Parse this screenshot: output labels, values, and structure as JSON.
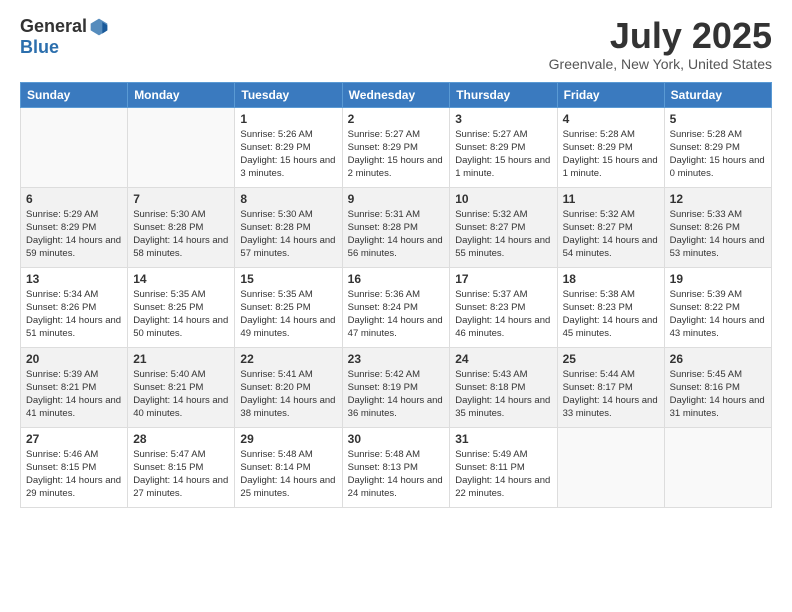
{
  "logo": {
    "general": "General",
    "blue": "Blue"
  },
  "title": {
    "month": "July 2025",
    "location": "Greenvale, New York, United States"
  },
  "headers": [
    "Sunday",
    "Monday",
    "Tuesday",
    "Wednesday",
    "Thursday",
    "Friday",
    "Saturday"
  ],
  "weeks": [
    [
      {
        "day": "",
        "info": ""
      },
      {
        "day": "",
        "info": ""
      },
      {
        "day": "1",
        "info": "Sunrise: 5:26 AM\nSunset: 8:29 PM\nDaylight: 15 hours and 3 minutes."
      },
      {
        "day": "2",
        "info": "Sunrise: 5:27 AM\nSunset: 8:29 PM\nDaylight: 15 hours and 2 minutes."
      },
      {
        "day": "3",
        "info": "Sunrise: 5:27 AM\nSunset: 8:29 PM\nDaylight: 15 hours and 1 minute."
      },
      {
        "day": "4",
        "info": "Sunrise: 5:28 AM\nSunset: 8:29 PM\nDaylight: 15 hours and 1 minute."
      },
      {
        "day": "5",
        "info": "Sunrise: 5:28 AM\nSunset: 8:29 PM\nDaylight: 15 hours and 0 minutes."
      }
    ],
    [
      {
        "day": "6",
        "info": "Sunrise: 5:29 AM\nSunset: 8:29 PM\nDaylight: 14 hours and 59 minutes."
      },
      {
        "day": "7",
        "info": "Sunrise: 5:30 AM\nSunset: 8:28 PM\nDaylight: 14 hours and 58 minutes."
      },
      {
        "day": "8",
        "info": "Sunrise: 5:30 AM\nSunset: 8:28 PM\nDaylight: 14 hours and 57 minutes."
      },
      {
        "day": "9",
        "info": "Sunrise: 5:31 AM\nSunset: 8:28 PM\nDaylight: 14 hours and 56 minutes."
      },
      {
        "day": "10",
        "info": "Sunrise: 5:32 AM\nSunset: 8:27 PM\nDaylight: 14 hours and 55 minutes."
      },
      {
        "day": "11",
        "info": "Sunrise: 5:32 AM\nSunset: 8:27 PM\nDaylight: 14 hours and 54 minutes."
      },
      {
        "day": "12",
        "info": "Sunrise: 5:33 AM\nSunset: 8:26 PM\nDaylight: 14 hours and 53 minutes."
      }
    ],
    [
      {
        "day": "13",
        "info": "Sunrise: 5:34 AM\nSunset: 8:26 PM\nDaylight: 14 hours and 51 minutes."
      },
      {
        "day": "14",
        "info": "Sunrise: 5:35 AM\nSunset: 8:25 PM\nDaylight: 14 hours and 50 minutes."
      },
      {
        "day": "15",
        "info": "Sunrise: 5:35 AM\nSunset: 8:25 PM\nDaylight: 14 hours and 49 minutes."
      },
      {
        "day": "16",
        "info": "Sunrise: 5:36 AM\nSunset: 8:24 PM\nDaylight: 14 hours and 47 minutes."
      },
      {
        "day": "17",
        "info": "Sunrise: 5:37 AM\nSunset: 8:23 PM\nDaylight: 14 hours and 46 minutes."
      },
      {
        "day": "18",
        "info": "Sunrise: 5:38 AM\nSunset: 8:23 PM\nDaylight: 14 hours and 45 minutes."
      },
      {
        "day": "19",
        "info": "Sunrise: 5:39 AM\nSunset: 8:22 PM\nDaylight: 14 hours and 43 minutes."
      }
    ],
    [
      {
        "day": "20",
        "info": "Sunrise: 5:39 AM\nSunset: 8:21 PM\nDaylight: 14 hours and 41 minutes."
      },
      {
        "day": "21",
        "info": "Sunrise: 5:40 AM\nSunset: 8:21 PM\nDaylight: 14 hours and 40 minutes."
      },
      {
        "day": "22",
        "info": "Sunrise: 5:41 AM\nSunset: 8:20 PM\nDaylight: 14 hours and 38 minutes."
      },
      {
        "day": "23",
        "info": "Sunrise: 5:42 AM\nSunset: 8:19 PM\nDaylight: 14 hours and 36 minutes."
      },
      {
        "day": "24",
        "info": "Sunrise: 5:43 AM\nSunset: 8:18 PM\nDaylight: 14 hours and 35 minutes."
      },
      {
        "day": "25",
        "info": "Sunrise: 5:44 AM\nSunset: 8:17 PM\nDaylight: 14 hours and 33 minutes."
      },
      {
        "day": "26",
        "info": "Sunrise: 5:45 AM\nSunset: 8:16 PM\nDaylight: 14 hours and 31 minutes."
      }
    ],
    [
      {
        "day": "27",
        "info": "Sunrise: 5:46 AM\nSunset: 8:15 PM\nDaylight: 14 hours and 29 minutes."
      },
      {
        "day": "28",
        "info": "Sunrise: 5:47 AM\nSunset: 8:15 PM\nDaylight: 14 hours and 27 minutes."
      },
      {
        "day": "29",
        "info": "Sunrise: 5:48 AM\nSunset: 8:14 PM\nDaylight: 14 hours and 25 minutes."
      },
      {
        "day": "30",
        "info": "Sunrise: 5:48 AM\nSunset: 8:13 PM\nDaylight: 14 hours and 24 minutes."
      },
      {
        "day": "31",
        "info": "Sunrise: 5:49 AM\nSunset: 8:11 PM\nDaylight: 14 hours and 22 minutes."
      },
      {
        "day": "",
        "info": ""
      },
      {
        "day": "",
        "info": ""
      }
    ]
  ]
}
